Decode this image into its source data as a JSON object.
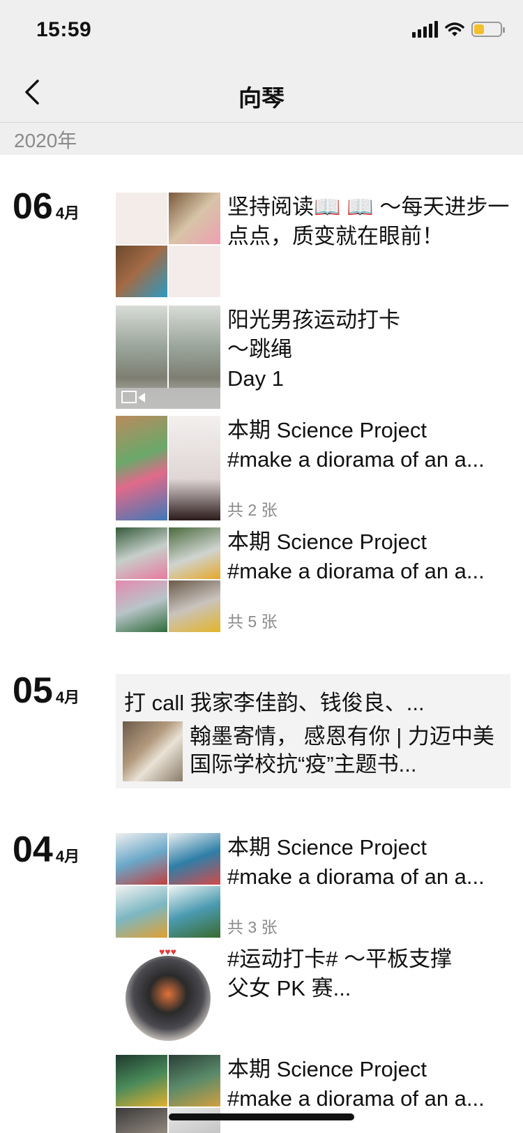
{
  "status": {
    "time": "15:59"
  },
  "nav": {
    "title": "向琴"
  },
  "year": "2020年",
  "days": [
    {
      "day": "06",
      "month": "4月"
    },
    {
      "day": "05",
      "month": "4月"
    },
    {
      "day": "04",
      "month": "4月"
    }
  ],
  "posts": [
    {
      "text": "坚持阅读📖 📖 ～每天进步一点点，质变就在眼前！"
    },
    {
      "line1": "阳光男孩运动打卡",
      "line2": "～跳绳",
      "line3": "Day 1"
    },
    {
      "line1": "本期 Science Project",
      "line2": "#make a diorama of an a...",
      "count": "共 2 张"
    },
    {
      "line1": "本期 Science Project",
      "line2": "#make a diorama of an a...",
      "count": "共 5 张"
    },
    {
      "line1": "本期 Science Project",
      "line2": "#make a diorama of an a...",
      "count": "共 3 张"
    },
    {
      "line1": "#运动打卡# ～平板支撑",
      "line2": "父女 PK 赛..."
    },
    {
      "line1": "本期 Science Project",
      "line2": "#make a diorama of an a..."
    }
  ],
  "share": {
    "title": "打 call 我家李佳韵、钱俊良、...",
    "text": "翰墨寄情， 感恩有你 | 力迈中美国际学校抗“疫”主题书..."
  }
}
